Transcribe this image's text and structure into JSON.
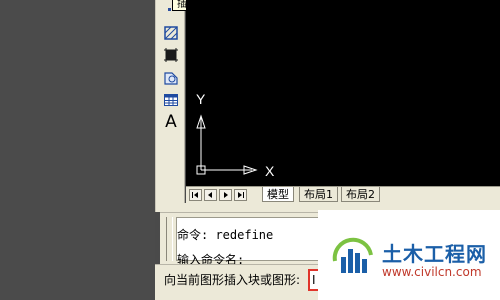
{
  "tooltip": {
    "text": "插入块"
  },
  "toolbar": {
    "tools": [
      {
        "name": "hatch-icon"
      },
      {
        "name": "region-icon"
      },
      {
        "name": "wipeout-icon"
      },
      {
        "name": "table-icon"
      },
      {
        "name": "text-icon",
        "glyph": "A"
      }
    ]
  },
  "canvas": {
    "background": "#000000",
    "ucs": {
      "y_label": "Y",
      "x_label": "X"
    }
  },
  "layout_tabs": {
    "nav_buttons": [
      "first-icon",
      "previous-icon",
      "next-icon",
      "last-icon"
    ],
    "tabs": [
      {
        "label": "模型",
        "active": true
      },
      {
        "label": "布局1",
        "active": false
      },
      {
        "label": "布局2",
        "active": false
      }
    ]
  },
  "command_line": {
    "history": "命令: redefine",
    "prompt": "输入命令名:"
  },
  "status_bar": {
    "text": "向当前图形插入块或图形:",
    "input_value": "I"
  },
  "watermark": {
    "title": "土木工程网",
    "url": "www.civilcn.com",
    "brand_color": "#1b5fa8"
  }
}
